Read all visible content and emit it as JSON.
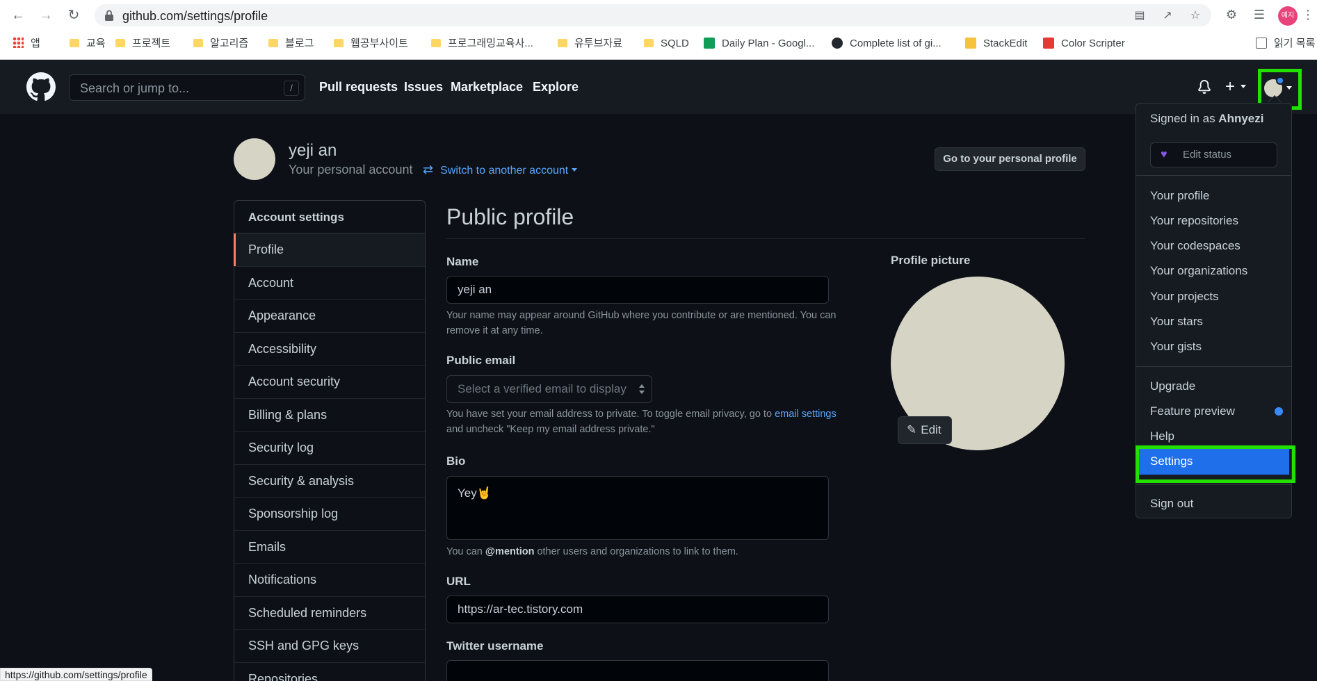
{
  "browser": {
    "url": "github.com/settings/profile",
    "profile_chip": "예지",
    "bookmarks": [
      "앱",
      "교육",
      "프로젝트",
      "알고리즘",
      "블로그",
      "웹공부사이트",
      "프로그래밍교육사...",
      "유투브자료",
      "SQLD",
      "Daily Plan - Googl...",
      "Complete list of gi...",
      "StackEdit",
      "Color Scripter",
      "읽기 목록"
    ],
    "status_url": "https://github.com/settings/profile"
  },
  "header": {
    "search_placeholder": "Search or jump to...",
    "search_key": "/",
    "nav": [
      "Pull requests",
      "Issues",
      "Marketplace",
      "Explore"
    ]
  },
  "account": {
    "name": "yeji an",
    "subtitle": "Your personal account",
    "switch_label": "Switch to another account",
    "profile_button": "Go to your personal profile"
  },
  "sidebar": {
    "heading": "Account settings",
    "items": [
      "Profile",
      "Account",
      "Appearance",
      "Accessibility",
      "Account security",
      "Billing & plans",
      "Security log",
      "Security & analysis",
      "Sponsorship log",
      "Emails",
      "Notifications",
      "Scheduled reminders",
      "SSH and GPG keys",
      "Repositories"
    ]
  },
  "main": {
    "title": "Public profile",
    "name_label": "Name",
    "name_value": "yeji an",
    "name_help": "Your name may appear around GitHub where you contribute or are mentioned. You can remove it at any time.",
    "email_label": "Public email",
    "email_placeholder": "Select a verified email to display",
    "email_help_pre": "You have set your email address to private. To toggle email privacy, go to ",
    "email_help_link": "email settings",
    "email_help_post": " and uncheck \"Keep my email address private.\"",
    "bio_label": "Bio",
    "bio_value": "Yey🤘",
    "bio_help_pre": "You can ",
    "bio_help_bold": "@mention",
    "bio_help_post": " other users and organizations to link to them.",
    "url_label": "URL",
    "url_value": "https://ar-tec.tistory.com",
    "twitter_label": "Twitter username",
    "picture_label": "Profile picture",
    "edit_label": "Edit"
  },
  "dropdown": {
    "signed_in_prefix": "Signed in as ",
    "username": "Ahnyezi",
    "edit_status": "Edit status",
    "group1": [
      "Your profile",
      "Your repositories",
      "Your codespaces",
      "Your organizations",
      "Your projects",
      "Your stars",
      "Your gists"
    ],
    "group2": [
      "Upgrade",
      "Feature preview",
      "Help"
    ],
    "settings": "Settings",
    "sign_out": "Sign out"
  },
  "colors": {
    "highlight": "#22e000",
    "accent": "#1f6feb",
    "link": "#58a6ff",
    "active_marker": "#f78166"
  }
}
